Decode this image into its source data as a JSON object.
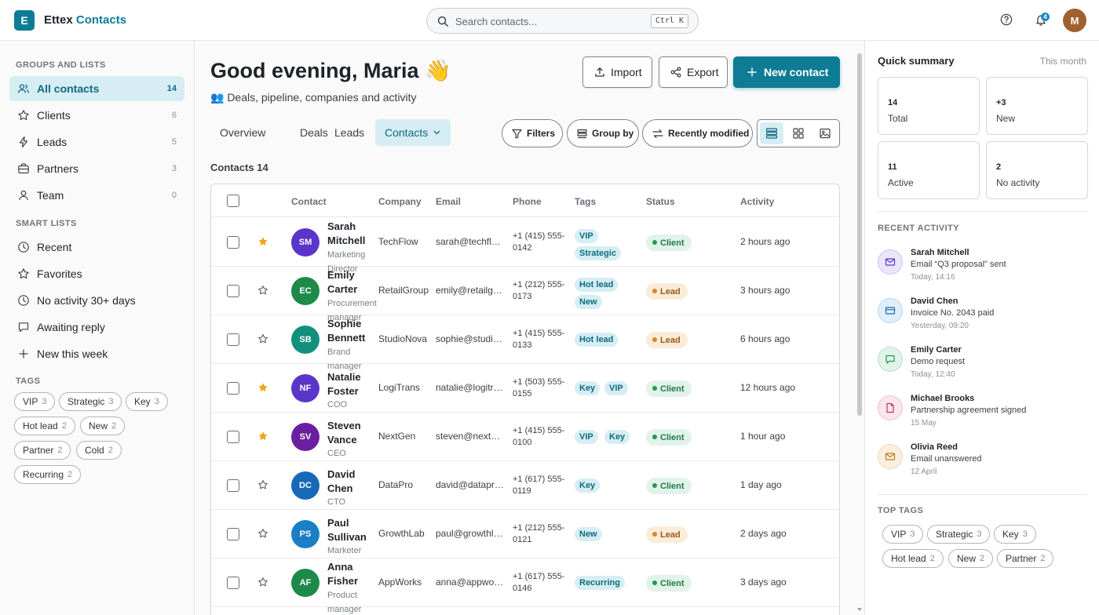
{
  "app": {
    "logo_letter": "E",
    "brand_name": "Ettex",
    "brand_accent": "Contacts",
    "accent_color": "#0f7c96"
  },
  "search": {
    "placeholder": "Search contacts...",
    "shortcut": "Ctrl K"
  },
  "topbar": {
    "notification_count": "4",
    "user_initial": "M"
  },
  "sidebar": {
    "groups_title": "GROUPS AND LISTS",
    "groups": [
      {
        "label": "All contacts",
        "count": "14",
        "icon": "users-icon"
      },
      {
        "label": "Clients",
        "count": "6",
        "icon": "star-icon"
      },
      {
        "label": "Leads",
        "count": "5",
        "icon": "lightning-icon"
      },
      {
        "label": "Partners",
        "count": "3",
        "icon": "briefcase-icon"
      },
      {
        "label": "Team",
        "count": "0",
        "icon": "user-icon"
      }
    ],
    "smart_title": "SMART LISTS",
    "smart": [
      {
        "label": "Recent",
        "icon": "clock-icon"
      },
      {
        "label": "Favorites",
        "icon": "star-icon"
      },
      {
        "label": "No activity 30+ days",
        "icon": "clock-icon"
      },
      {
        "label": "Awaiting reply",
        "icon": "message-icon"
      },
      {
        "label": "New this week",
        "icon": "plus-icon"
      }
    ],
    "tags_title": "TAGS",
    "tags": [
      {
        "label": "VIP",
        "count": "3"
      },
      {
        "label": "Strategic",
        "count": "3"
      },
      {
        "label": "Key",
        "count": "3"
      },
      {
        "label": "Hot lead",
        "count": "2"
      },
      {
        "label": "New",
        "count": "2"
      },
      {
        "label": "Partner",
        "count": "2"
      },
      {
        "label": "Cold",
        "count": "2"
      },
      {
        "label": "Recurring",
        "count": "2"
      }
    ]
  },
  "main": {
    "greeting": "Good evening, Maria 👋",
    "subtitle": "👥 Deals, pipeline, companies and activity",
    "import_label": "Import",
    "export_label": "Export",
    "new_contact_label": "New contact",
    "tabs": [
      "Overview",
      "Deals",
      "Leads",
      "Contacts"
    ],
    "filters_label": "Filters",
    "groupby_label": "Group by",
    "sort_label": "Recently modified",
    "count_title": "Contacts 14"
  },
  "table": {
    "headers": {
      "contact": "Contact",
      "company": "Company",
      "email": "Email",
      "phone": "Phone",
      "tags": "Tags",
      "status": "Status",
      "activity": "Activity"
    },
    "rows": [
      {
        "initials": "SM",
        "color": "#5b35c9",
        "first": "Sarah",
        "last": "Mitchell",
        "role1": "Marketing",
        "role2": "Director",
        "company": "TechFlow",
        "email": "sarah@techflow.com",
        "phone1": "+1 (415) 555-",
        "phone2": "0142",
        "tags": [
          "VIP",
          "Strategic"
        ],
        "status": "Client",
        "activity": "2 hours ago",
        "starred": true
      },
      {
        "initials": "EC",
        "color": "#1e8a4a",
        "first": "Emily",
        "last": "Carter",
        "role1": "Procurement",
        "role2": "manager",
        "company": "RetailGroup",
        "email": "emily@retailgroup.com",
        "phone1": "+1 (212) 555-",
        "phone2": "0173",
        "tags": [
          "Hot lead",
          "New"
        ],
        "status": "Lead",
        "activity": "3 hours ago",
        "starred": false
      },
      {
        "initials": "SB",
        "color": "#138f7e",
        "first": "Sophie",
        "last": "Bennett",
        "role1": "Brand",
        "role2": "manager",
        "company": "StudioNova",
        "email": "sophie@studionova.com",
        "phone1": "+1 (415) 555-",
        "phone2": "0133",
        "tags": [
          "Hot lead"
        ],
        "status": "Lead",
        "activity": "6 hours ago",
        "starred": false
      },
      {
        "initials": "NF",
        "color": "#5b35c9",
        "first": "Natalie",
        "last": "Foster",
        "role1": "COO",
        "role2": "",
        "company": "LogiTrans",
        "email": "natalie@logitrans.com",
        "phone1": "+1 (503) 555-",
        "phone2": "0155",
        "tags": [
          "Key",
          "VIP"
        ],
        "status": "Client",
        "activity": "12 hours ago",
        "starred": true
      },
      {
        "initials": "SV",
        "color": "#6a1fa0",
        "first": "Steven",
        "last": "Vance",
        "role1": "CEO",
        "role2": "",
        "company": "NextGen",
        "email": "steven@nextgen.com",
        "phone1": "+1 (415) 555-",
        "phone2": "0100",
        "tags": [
          "VIP",
          "Key"
        ],
        "status": "Client",
        "activity": "1 hour ago",
        "starred": true
      },
      {
        "initials": "DC",
        "color": "#1769b8",
        "first": "David",
        "last": "Chen",
        "role1": "CTO",
        "role2": "",
        "company": "DataPro",
        "email": "david@datapro.com",
        "phone1": "+1 (617) 555-",
        "phone2": "0119",
        "tags": [
          "Key"
        ],
        "status": "Client",
        "activity": "1 day ago",
        "starred": false
      },
      {
        "initials": "PS",
        "color": "#1a7fc4",
        "first": "Paul",
        "last": "Sullivan",
        "role1": "Marketer",
        "role2": "",
        "company": "GrowthLab",
        "email": "paul@growthlab.com",
        "phone1": "+1 (212) 555-",
        "phone2": "0121",
        "tags": [
          "New"
        ],
        "status": "Lead",
        "activity": "2 days ago",
        "starred": false
      },
      {
        "initials": "AF",
        "color": "#1e8a4a",
        "first": "Anna",
        "last": "Fisher",
        "role1": "Product",
        "role2": "manager",
        "company": "AppWorks",
        "email": "anna@appworks.com",
        "phone1": "+1 (617) 555-",
        "phone2": "0146",
        "tags": [
          "Recurring"
        ],
        "status": "Client",
        "activity": "3 days ago",
        "starred": false
      }
    ]
  },
  "summary": {
    "title": "Quick summary",
    "period": "This month",
    "cards": [
      {
        "value": "14",
        "label": "Total"
      },
      {
        "value": "+3",
        "label": "New"
      },
      {
        "value": "11",
        "label": "Active"
      },
      {
        "value": "2",
        "label": "No activity"
      }
    ],
    "recent_title": "RECENT ACTIVITY",
    "activity": [
      {
        "name": "Sarah Mitchell",
        "desc": "Email “Q3 proposal” sent",
        "time": "Today, 14:16",
        "icon": "mail-icon",
        "bg": "#ece6fb",
        "fg": "#5b35c9"
      },
      {
        "name": "David Chen",
        "desc": "Invoice No. 2043 paid",
        "time": "Yesterday, 09:20",
        "icon": "card-icon",
        "bg": "#e1effb",
        "fg": "#1769b8"
      },
      {
        "name": "Emily Carter",
        "desc": "Demo request",
        "time": "Today, 12:40",
        "icon": "message-icon",
        "bg": "#e2f3ea",
        "fg": "#1f9a55"
      },
      {
        "name": "Michael Brooks",
        "desc": "Partnership agreement signed",
        "time": "15 May",
        "icon": "document-icon",
        "bg": "#fbe6ee",
        "fg": "#c0345f"
      },
      {
        "name": "Olivia Reed",
        "desc": "Email unanswered",
        "time": "12 April",
        "icon": "mail-icon",
        "bg": "#fbf0df",
        "fg": "#c07a1a"
      }
    ],
    "top_tags_title": "TOP TAGS",
    "top_tags": [
      {
        "label": "VIP",
        "count": "3"
      },
      {
        "label": "Strategic",
        "count": "3"
      },
      {
        "label": "Key",
        "count": "3"
      },
      {
        "label": "Hot lead",
        "count": "2"
      },
      {
        "label": "New",
        "count": "2"
      },
      {
        "label": "Partner",
        "count": "2"
      }
    ]
  }
}
